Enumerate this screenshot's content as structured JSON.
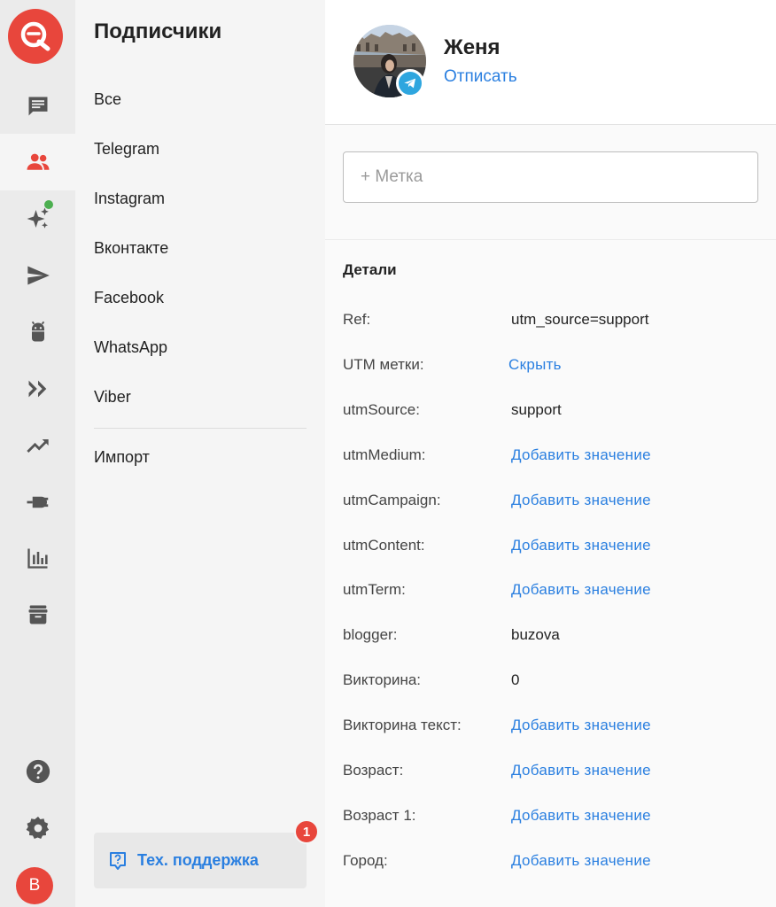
{
  "rail": {
    "logo": "chat-logo-icon",
    "icons": [
      "messages-icon",
      "subscribers-icon",
      "sparkles-icon",
      "send-icon",
      "bot-icon",
      "funnel-icon",
      "trending-icon",
      "plug-icon",
      "stats-icon",
      "archive-icon"
    ],
    "bottom_icons": [
      "help-icon",
      "settings-icon"
    ],
    "avatar_letter": "B",
    "accent": "#e8463c"
  },
  "subnav": {
    "title": "Подписчики",
    "items": [
      "Все",
      "Telegram",
      "Instagram",
      "Вконтакте",
      "Facebook",
      "WhatsApp",
      "Viber"
    ],
    "import_label": "Импорт",
    "support_label": "Тех. поддержка",
    "support_badge": "1"
  },
  "profile": {
    "name": "Женя",
    "unsubscribe_label": "Отписать",
    "channel_icon": "telegram-icon",
    "tag_placeholder": "+ Метка"
  },
  "details": {
    "title": "Детали",
    "rows": [
      {
        "key": "Ref:",
        "value": "utm_source=support",
        "link": false
      },
      {
        "key": "UTM метки:",
        "value": "Скрыть",
        "link": true
      },
      {
        "key": "utmSource:",
        "value": "support",
        "link": false
      },
      {
        "key": "utmMedium:",
        "value": "Добавить значение",
        "link": true
      },
      {
        "key": "utmCampaign:",
        "value": "Добавить значение",
        "link": true
      },
      {
        "key": "utmContent:",
        "value": "Добавить значение",
        "link": true
      },
      {
        "key": "utmTerm:",
        "value": "Добавить значение",
        "link": true
      },
      {
        "key": "blogger:",
        "value": "buzova",
        "link": false
      },
      {
        "key": "Викторина:",
        "value": "0",
        "link": false
      },
      {
        "key": "Викторина текст:",
        "value": "Добавить значение",
        "link": true
      },
      {
        "key": "Возраст:",
        "value": "Добавить значение",
        "link": true
      },
      {
        "key": "Возраст 1:",
        "value": "Добавить значение",
        "link": true
      },
      {
        "key": "Город:",
        "value": "Добавить значение",
        "link": true
      }
    ]
  },
  "colors": {
    "link": "#2a7fe0",
    "brand": "#e8463c",
    "online": "#4caf50"
  }
}
